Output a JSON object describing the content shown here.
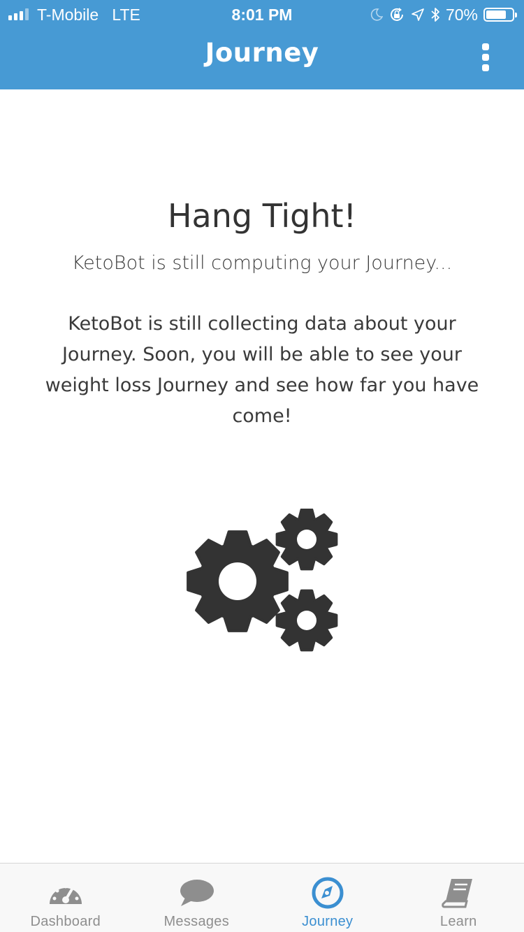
{
  "status_bar": {
    "carrier": "T-Mobile",
    "network": "LTE",
    "time": "8:01 PM",
    "battery_percent": "70%",
    "battery_level": 0.7,
    "icons": [
      "signal-icon",
      "moon-icon",
      "orientation-lock-icon",
      "location-arrow-icon",
      "bluetooth-icon",
      "battery-icon"
    ]
  },
  "navbar": {
    "title": "Journey",
    "menu_icon": "more-vertical-icon"
  },
  "main": {
    "heading": "Hang Tight!",
    "subheading": "KetoBot is still computing your Journey...",
    "body": "KetoBot is still collecting data about your Journey. Soon, you will be able to see your weight loss Journey and see how far you have come!",
    "illustration_icon": "gears-icon"
  },
  "tabbar": {
    "tabs": [
      {
        "label": "Dashboard",
        "icon": "speedometer-icon",
        "active": false
      },
      {
        "label": "Messages",
        "icon": "chat-bubble-icon",
        "active": false
      },
      {
        "label": "Journey",
        "icon": "compass-icon",
        "active": true
      },
      {
        "label": "Learn",
        "icon": "book-icon",
        "active": false
      }
    ]
  },
  "colors": {
    "header_blue": "#479ad4",
    "active_tab": "#3b8fd1",
    "inactive_tab": "#8e8e8e",
    "gear": "#333333"
  }
}
